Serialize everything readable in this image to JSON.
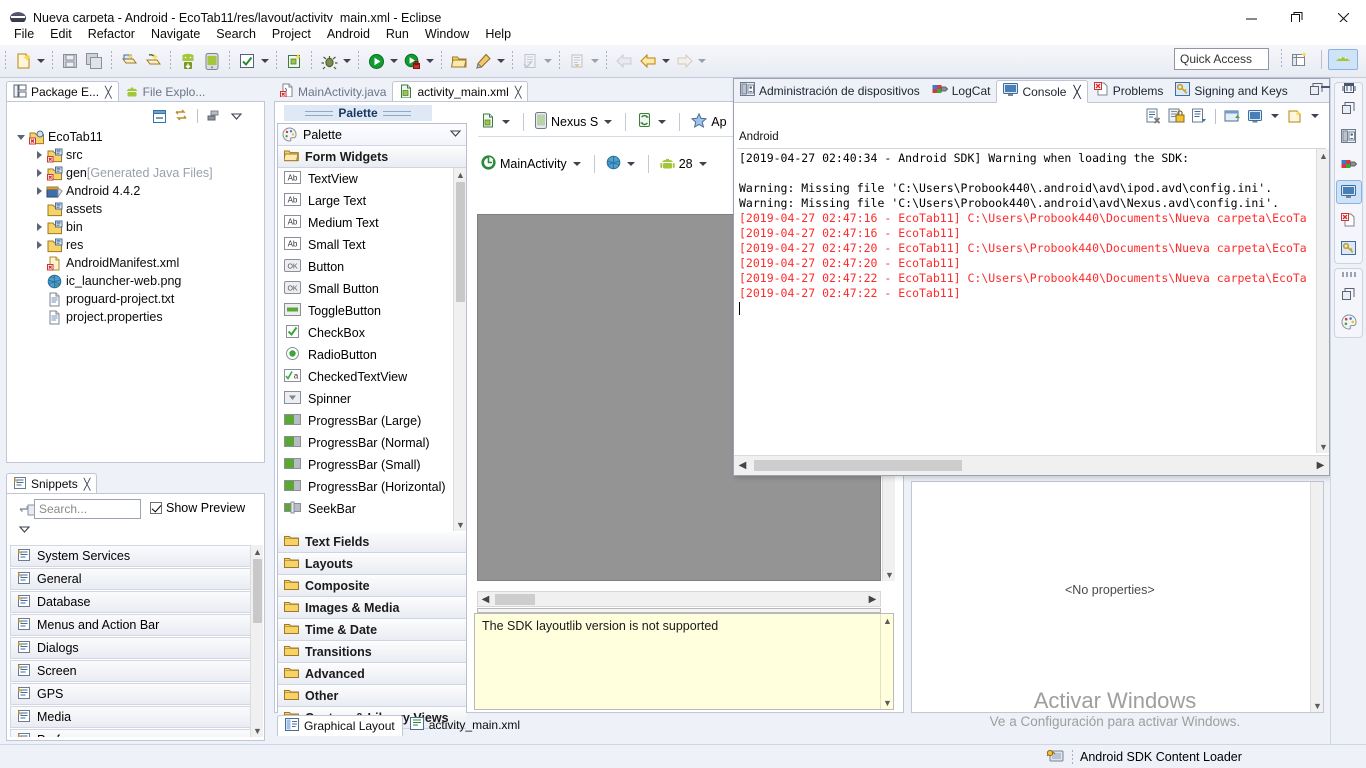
{
  "window": {
    "title": "Nueva carpeta - Android - EcoTab11/res/layout/activity_main.xml - Eclipse",
    "minimize": "—",
    "maximize": "❐",
    "close": "✕"
  },
  "menubar": [
    "File",
    "Edit",
    "Refactor",
    "Navigate",
    "Search",
    "Project",
    "Android",
    "Run",
    "Window",
    "Help"
  ],
  "toolbar": {
    "quick_access_placeholder": "Quick Access",
    "icons": [
      "new-file-icon",
      "save-icon",
      "save-all-icon",
      "print-icon",
      "export-icon",
      "android-sdk-manager-icon",
      "android-avd-manager-icon",
      "check-icon",
      "new-android-project-icon",
      "debug-icon",
      "run-icon",
      "run-secure-icon",
      "open-folder-icon",
      "quick-fix-icon",
      "next-annotation-icon",
      "previous-edit-icon",
      "back-icon",
      "forward-icon"
    ],
    "perspective_icons": [
      "open-perspective-icon",
      "android-perspective-icon"
    ]
  },
  "package_explorer": {
    "tabs": [
      {
        "label": "Package E...",
        "icon": "package-explorer-icon",
        "active": true,
        "closable": true
      },
      {
        "label": "File Explo...",
        "icon": "android-file-explorer-icon",
        "active": false,
        "closable": false
      }
    ],
    "view_buttons": [
      "collapse-all-icon",
      "link-with-editor-icon",
      "view-menu-icon",
      "view-dropdown-icon"
    ],
    "tree": [
      {
        "label": "EcoTab11",
        "icon": "android-project-icon",
        "indent": 0,
        "twisty": "down"
      },
      {
        "label": "src",
        "icon": "source-folder-icon",
        "indent": 1,
        "twisty": "right"
      },
      {
        "label": "gen",
        "suffix": "[Generated Java Files]",
        "icon": "source-folder-icon",
        "indent": 1,
        "twisty": "right"
      },
      {
        "label": "Android 4.4.2",
        "icon": "library-icon",
        "indent": 1,
        "twisty": "right"
      },
      {
        "label": "assets",
        "icon": "folder-icon",
        "indent": 1,
        "twisty": "none"
      },
      {
        "label": "bin",
        "icon": "folder-icon",
        "indent": 1,
        "twisty": "right"
      },
      {
        "label": "res",
        "icon": "folder-icon",
        "indent": 1,
        "twisty": "right"
      },
      {
        "label": "AndroidManifest.xml",
        "icon": "android-manifest-icon",
        "indent": 1,
        "twisty": "none"
      },
      {
        "label": "ic_launcher-web.png",
        "icon": "image-file-icon",
        "indent": 1,
        "twisty": "none"
      },
      {
        "label": "proguard-project.txt",
        "icon": "text-file-icon",
        "indent": 1,
        "twisty": "none"
      },
      {
        "label": "project.properties",
        "icon": "text-file-icon",
        "indent": 1,
        "twisty": "none"
      }
    ]
  },
  "snippets": {
    "tab_label": "Snippets",
    "search_placeholder": "Search...",
    "show_preview_label": "Show Preview",
    "show_preview_checked": true,
    "items": [
      "System Services",
      "General",
      "Database",
      "Menus and Action Bar",
      "Dialogs",
      "Screen",
      "GPS",
      "Media",
      "Preferences"
    ]
  },
  "editor": {
    "tabs": [
      {
        "label": "MainActivity.java",
        "icon": "java-file-icon",
        "active": false,
        "closable": false
      },
      {
        "label": "activity_main.xml",
        "icon": "xml-layout-file-icon",
        "active": true,
        "closable": true
      }
    ],
    "bottom_tabs": [
      {
        "label": "Graphical Layout",
        "icon": "graphical-layout-icon",
        "active": true
      },
      {
        "label": "activity_main.xml",
        "icon": "xml-source-icon",
        "active": false
      }
    ]
  },
  "palette": {
    "header": "Palette",
    "title": "Palette",
    "category_open": "Form Widgets",
    "widgets": [
      {
        "label": "TextView",
        "icon": "ab-text-icon"
      },
      {
        "label": "Large Text",
        "icon": "ab-text-icon"
      },
      {
        "label": "Medium Text",
        "icon": "ab-text-icon"
      },
      {
        "label": "Small Text",
        "icon": "ab-text-icon"
      },
      {
        "label": "Button",
        "icon": "ok-button-icon"
      },
      {
        "label": "Small Button",
        "icon": "ok-button-icon"
      },
      {
        "label": "ToggleButton",
        "icon": "toggle-button-icon"
      },
      {
        "label": "CheckBox",
        "icon": "checkbox-icon"
      },
      {
        "label": "RadioButton",
        "icon": "radio-button-icon"
      },
      {
        "label": "CheckedTextView",
        "icon": "checked-textview-icon"
      },
      {
        "label": "Spinner",
        "icon": "spinner-icon"
      },
      {
        "label": "ProgressBar (Large)",
        "icon": "progressbar-icon"
      },
      {
        "label": "ProgressBar (Normal)",
        "icon": "progressbar-icon"
      },
      {
        "label": "ProgressBar (Small)",
        "icon": "progressbar-icon"
      },
      {
        "label": "ProgressBar (Horizontal)",
        "icon": "progressbar-icon"
      },
      {
        "label": "SeekBar",
        "icon": "seekbar-icon"
      }
    ],
    "categories": [
      "Text Fields",
      "Layouts",
      "Composite",
      "Images & Media",
      "Time & Date",
      "Transitions",
      "Advanced",
      "Other",
      "Custom & Library Views"
    ]
  },
  "layout_toolbar": {
    "row1": [
      {
        "label": "",
        "icon": "config-chooser-icon",
        "dropdown": true
      },
      {
        "label": "Nexus S",
        "icon": "device-icon",
        "dropdown": true
      },
      {
        "label": "",
        "icon": "orientation-icon",
        "dropdown": true
      },
      {
        "label": "Ap",
        "icon": "theme-star-icon",
        "dropdown": false
      }
    ],
    "row2": [
      {
        "label": "MainActivity",
        "icon": "activity-icon",
        "dropdown": true
      },
      {
        "label": "",
        "icon": "locale-globe-icon",
        "dropdown": true
      },
      {
        "label": "28",
        "icon": "android-api-icon",
        "dropdown": true
      }
    ]
  },
  "error_panel": {
    "message": "The SDK layoutlib version is not supported"
  },
  "console_panel": {
    "tabs": [
      {
        "label": "Administración de dispositivos",
        "icon": "devices-icon",
        "active": false
      },
      {
        "label": "LogCat",
        "icon": "logcat-icon",
        "active": false
      },
      {
        "label": "Console",
        "icon": "console-icon",
        "active": true,
        "closable": true
      },
      {
        "label": "Problems",
        "icon": "problems-icon",
        "active": false
      },
      {
        "label": "Signing and Keys",
        "icon": "signing-keys-icon",
        "active": false
      }
    ],
    "restore_icon": "restore-view-icon",
    "toolbar_icons": [
      "clear-console-icon",
      "scroll-lock-icon",
      "pin-console-icon",
      "display-selected-console-icon",
      "open-console-icon",
      "open-console-dropdown-icon",
      "new-console-view-icon",
      "new-console-dropdown-icon"
    ],
    "source_label": "Android",
    "lines": [
      {
        "text": "[2019-04-27 02:40:34 - Android SDK] Warning when loading the SDK:",
        "color": "#000000"
      },
      {
        "text": "",
        "color": "#000000"
      },
      {
        "text": "Warning: Missing file 'C:\\Users\\Probook440\\.android\\avd\\ipod.avd\\config.ini'.",
        "color": "#000000"
      },
      {
        "text": "Warning: Missing file 'C:\\Users\\Probook440\\.android\\avd\\Nexus.avd\\config.ini'.",
        "color": "#000000"
      },
      {
        "text": "[2019-04-27 02:47:16 - EcoTab11] C:\\Users\\Probook440\\Documents\\Nueva carpeta\\EcoTa",
        "color": "#ff2b2b"
      },
      {
        "text": "[2019-04-27 02:47:16 - EcoTab11]",
        "color": "#ff2b2b"
      },
      {
        "text": "[2019-04-27 02:47:20 - EcoTab11] C:\\Users\\Probook440\\Documents\\Nueva carpeta\\EcoTa",
        "color": "#ff2b2b"
      },
      {
        "text": "[2019-04-27 02:47:20 - EcoTab11]",
        "color": "#ff2b2b"
      },
      {
        "text": "[2019-04-27 02:47:22 - EcoTab11] C:\\Users\\Probook440\\Documents\\Nueva carpeta\\EcoTa",
        "color": "#ff2b2b"
      },
      {
        "text": "[2019-04-27 02:47:22 - EcoTab11]",
        "color": "#ff2b2b"
      }
    ]
  },
  "properties_panel": {
    "empty_text": "<No properties>"
  },
  "watermark": {
    "line1": "Activar Windows",
    "line2": "Ve a Configuración para activar Windows."
  },
  "statusbar": {
    "icon": "sdk-loader-icon",
    "text": "Android SDK Content Loader"
  },
  "rail": {
    "groups": [
      {
        "buttons": [
          {
            "icon": "restore-icon",
            "selected": false
          },
          {
            "icon": "devices-icon",
            "selected": false
          },
          {
            "icon": "logcat-icon",
            "selected": false
          },
          {
            "icon": "console-icon",
            "selected": true
          },
          {
            "icon": "problems-icon",
            "selected": false
          },
          {
            "icon": "signing-keys-icon",
            "selected": false
          }
        ]
      },
      {
        "buttons": [
          {
            "icon": "restore-icon",
            "selected": false
          },
          {
            "icon": "palette-icon",
            "selected": false
          }
        ]
      }
    ]
  },
  "colors": {
    "accent": "#2a6099",
    "error_red": "#ff2b2b",
    "panel_bg": "#eef1f8",
    "canvas_gray": "#949494",
    "error_yellow": "#ffffdd"
  }
}
